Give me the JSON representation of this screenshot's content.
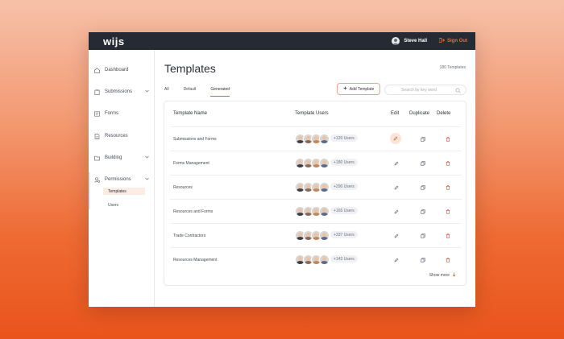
{
  "app": {
    "logo": "wijs"
  },
  "topbar": {
    "user_name": "Steve Hall",
    "signout_label": "Sign Out"
  },
  "sidebar": {
    "items": [
      {
        "label": "Dashboard",
        "icon": "home-icon"
      },
      {
        "label": "Submissions",
        "icon": "clipboard-icon",
        "expandable": true
      },
      {
        "label": "Forms",
        "icon": "form-icon"
      },
      {
        "label": "Resources",
        "icon": "document-icon"
      },
      {
        "label": "Building",
        "icon": "folder-icon",
        "expandable": true
      },
      {
        "label": "Permissions",
        "icon": "user-shield-icon",
        "expandable": true
      }
    ],
    "subitems": [
      {
        "label": "Templates",
        "active": true
      },
      {
        "label": "Users",
        "active": false
      }
    ]
  },
  "page": {
    "title": "Templates",
    "count": "180 Templates",
    "tabs": [
      {
        "label": "All"
      },
      {
        "label": "Default"
      },
      {
        "label": "Generated",
        "active": true
      }
    ],
    "add_button": "Add Template",
    "search_placeholder": "Search by key word"
  },
  "table": {
    "headers": {
      "name": "Template Name",
      "users": "Template Users",
      "edit": "Edit",
      "duplicate": "Duplicate",
      "delete": "Delete"
    },
    "rows": [
      {
        "name": "Submissions and Forms",
        "users": "+120 Users"
      },
      {
        "name": "Forms Management",
        "users": "+180 Users"
      },
      {
        "name": "Resources",
        "users": "+290 Users"
      },
      {
        "name": "Resources and Forms",
        "users": "+165 Users"
      },
      {
        "name": "Trade Contractors",
        "users": "+337 Users"
      },
      {
        "name": "Resources Management",
        "users": "+143 Users"
      }
    ],
    "show_more": "Show more"
  },
  "colors": {
    "accent": "#ef5a2a",
    "topbar": "#262b33",
    "delete": "#e04a3c"
  }
}
